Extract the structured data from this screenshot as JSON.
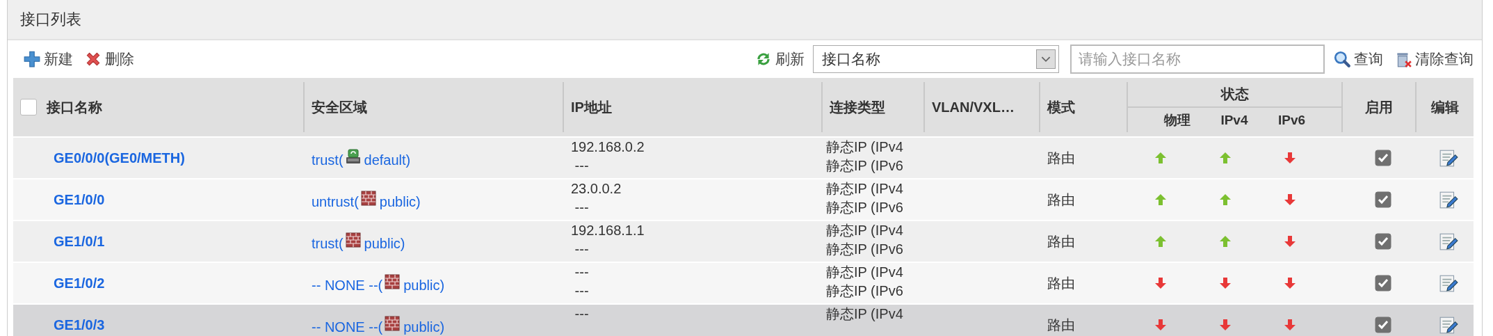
{
  "panel": {
    "title": "接口列表"
  },
  "toolbar": {
    "new": "新建",
    "delete": "删除",
    "refresh": "刷新",
    "filter_select": "接口名称",
    "search": {
      "placeholder": "请输入接口名称"
    },
    "query": "查询",
    "clear_query": "清除查询"
  },
  "table": {
    "select_all": {
      "checked": false
    },
    "columns": [
      "接口名称",
      "安全区域",
      "IP地址",
      "连接类型",
      "VLAN/VXL…",
      "模式",
      "状态",
      "启用",
      "编辑"
    ],
    "status_columns": [
      "物理",
      "IPv4",
      "IPv6"
    ],
    "rows": [
      {
        "name": "GE0/0/0(GE0/METH)",
        "zone_text": "trust(",
        "kind": "device",
        "vsys_text": "default)",
        "ip": [
          "192.168.0.2",
          " ---"
        ],
        "connection": [
          "静态IP (IPv4",
          "静态IP (IPv6"
        ],
        "mode": "路由",
        "physical_up": true,
        "ipv4_up": true,
        "ipv6_up": false,
        "enabled": true,
        "selected": false
      },
      {
        "name": "GE1/0/0",
        "zone_text": "untrust(",
        "kind": "wall",
        "vsys_text": "public)",
        "ip": [
          "23.0.0.2",
          " ---"
        ],
        "connection": [
          "静态IP (IPv4",
          "静态IP (IPv6"
        ],
        "mode": "路由",
        "physical_up": true,
        "ipv4_up": true,
        "ipv6_up": false,
        "enabled": true,
        "selected": false
      },
      {
        "name": "GE1/0/1",
        "zone_text": "trust(",
        "kind": "wall",
        "vsys_text": "public)",
        "ip": [
          "192.168.1.1",
          " ---"
        ],
        "connection": [
          "静态IP (IPv4",
          "静态IP (IPv6"
        ],
        "mode": "路由",
        "physical_up": true,
        "ipv4_up": true,
        "ipv6_up": false,
        "enabled": true,
        "selected": false
      },
      {
        "name": "GE1/0/2",
        "zone_text": "-- NONE --(",
        "kind": "wall",
        "vsys_text": "public)",
        "ip": [
          " ---",
          " ---"
        ],
        "connection": [
          "静态IP (IPv4",
          "静态IP (IPv6"
        ],
        "mode": "路由",
        "physical_up": false,
        "ipv4_up": false,
        "ipv6_up": false,
        "enabled": true,
        "selected": false
      },
      {
        "name": "GE1/0/3",
        "zone_text": "-- NONE --(",
        "kind": "wall",
        "vsys_text": "public)",
        "ip": [
          " ---"
        ],
        "connection": [
          "静态IP (IPv4"
        ],
        "mode": "路由",
        "physical_up": false,
        "ipv4_up": false,
        "ipv6_up": false,
        "enabled": true,
        "selected": true
      }
    ]
  }
}
